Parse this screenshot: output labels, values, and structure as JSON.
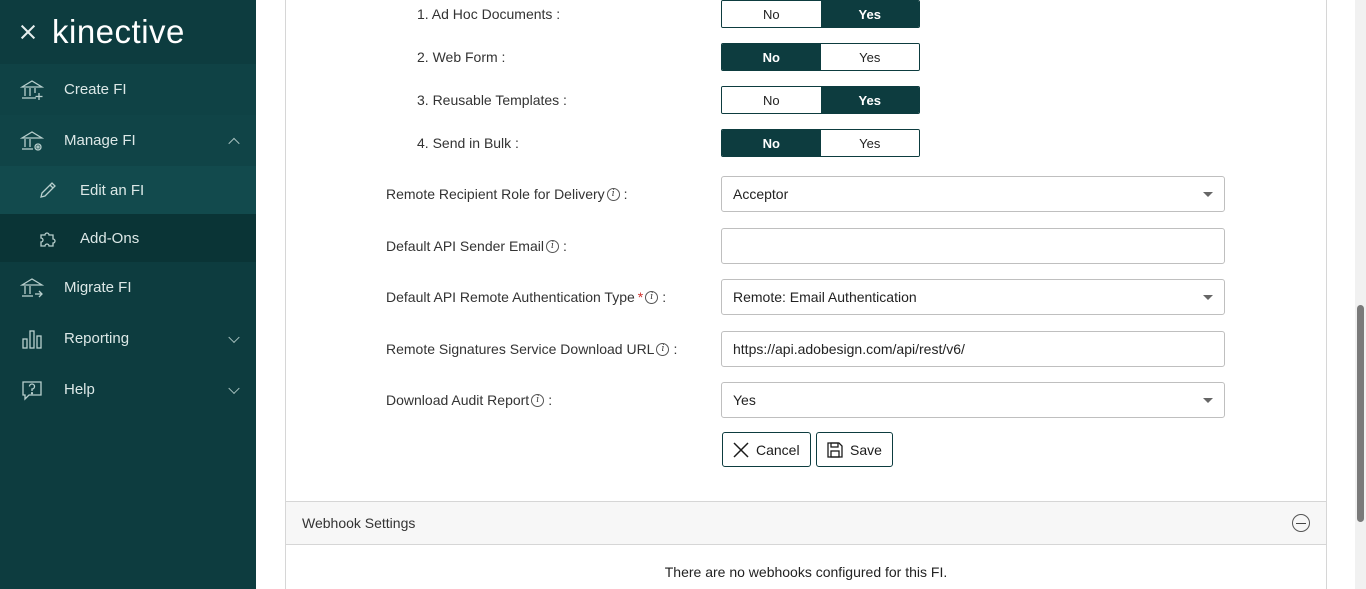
{
  "sidebar": {
    "brand": "kinective",
    "items": [
      {
        "label": "Create FI",
        "icon": "bank-plus-icon"
      },
      {
        "label": "Manage FI",
        "icon": "bank-gear-icon"
      },
      {
        "label": "Edit an FI",
        "icon": "pencil-icon"
      },
      {
        "label": "Add-Ons",
        "icon": "puzzle-icon"
      },
      {
        "label": "Migrate FI",
        "icon": "bank-arrow-icon"
      },
      {
        "label": "Reporting",
        "icon": "bar-chart-icon"
      },
      {
        "label": "Help",
        "icon": "help-bubble-icon"
      }
    ]
  },
  "options": [
    {
      "label": "1. Ad Hoc Documents :",
      "no": "No",
      "yes": "Yes",
      "selected": "Yes"
    },
    {
      "label": "2. Web Form :",
      "no": "No",
      "yes": "Yes",
      "selected": "No"
    },
    {
      "label": "3. Reusable Templates :",
      "no": "No",
      "yes": "Yes",
      "selected": "Yes"
    },
    {
      "label": "4. Send in Bulk :",
      "no": "No",
      "yes": "Yes",
      "selected": "No"
    }
  ],
  "fields": {
    "recipient_role": {
      "label": "Remote Recipient Role for Delivery",
      "suffix": ":",
      "value": "Acceptor"
    },
    "sender_email": {
      "label": "Default API Sender Email",
      "suffix": ":",
      "value": ""
    },
    "auth_type": {
      "label": "Default API Remote Authentication Type",
      "required": "*",
      "suffix": ":",
      "value": "Remote: Email Authentication"
    },
    "download_url": {
      "label": "Remote Signatures Service Download URL",
      "suffix": ":",
      "value": "https://api.adobesign.com/api/rest/v6/"
    },
    "audit_report": {
      "label": "Download Audit Report",
      "suffix": ":",
      "value": "Yes"
    }
  },
  "info_glyph": "i",
  "buttons": {
    "cancel": "Cancel",
    "save": "Save"
  },
  "webhook": {
    "title": "Webhook Settings",
    "empty_message": "There are no webhooks configured for this FI."
  },
  "colors": {
    "brand": "#0d3c3f",
    "required": "#d0312d"
  }
}
